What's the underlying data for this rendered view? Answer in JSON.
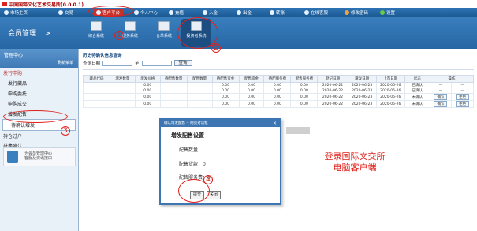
{
  "window": {
    "title": "中国国粹文化艺术交易所(0.0.0.1)"
  },
  "topnav": {
    "items": [
      {
        "label": "市场主页",
        "icon": "home-icon"
      },
      {
        "label": "交易",
        "icon": "trade-icon"
      },
      {
        "label": "客户平台",
        "icon": "client-icon",
        "active": true
      },
      {
        "label": "个人中心",
        "icon": "user-icon"
      },
      {
        "label": "充值",
        "icon": "recharge-icon"
      },
      {
        "label": "入金",
        "icon": "deposit-icon"
      },
      {
        "label": "出金",
        "icon": "withdraw-icon"
      },
      {
        "label": "转账",
        "icon": "transfer-icon"
      },
      {
        "label": "在线客服",
        "icon": "service-icon"
      },
      {
        "label": "修改密码",
        "icon": "key-icon"
      },
      {
        "label": "设置",
        "icon": "settings-icon"
      }
    ]
  },
  "header": {
    "member_label": "会员管理",
    "member_arrow": ">",
    "systems": [
      {
        "label": "综合系统",
        "icon": "system-icon"
      },
      {
        "label": "服务系统",
        "icon": "service-system-icon"
      },
      {
        "label": "仓单系统",
        "icon": "warehouse-icon"
      },
      {
        "label": "投资者系统",
        "icon": "investor-icon",
        "active": true
      }
    ]
  },
  "sidebar": {
    "title": "管理中心",
    "refresh": "刷新菜单",
    "section_issue": "发行申购",
    "items": [
      "发行藏品",
      "申购委托",
      "申购成交",
      "增发配售",
      "待确认增发"
    ],
    "active_item": "待确认增发",
    "section_settle": "持仓过户",
    "section_pay": "付费确认",
    "promo": {
      "line1": "为会员管理中心",
      "line2": "客服及资讯接口"
    }
  },
  "content": {
    "section_title": "历史待确认信息查询",
    "query": {
      "label": "查询日期",
      "to": "至",
      "button": "查询"
    },
    "columns": [
      "藏品代码",
      "增发数量",
      "增发价格",
      "待配售数量",
      "配售数量",
      "待配售资金",
      "配售资金",
      "待配服务费",
      "配售服务费",
      "登记日期",
      "增发日期",
      "上市日期",
      "状态",
      "操作"
    ],
    "rows": [
      [
        "",
        "",
        "0.00",
        "",
        "",
        "0.00",
        "0.00",
        "0.00",
        "0.00",
        "2020-06-22",
        "2020-06-23",
        "2020-06-26",
        "已确认",
        "—",
        "—"
      ],
      [
        "",
        "",
        "0.00",
        "",
        "",
        "0.00",
        "0.00",
        "0.00",
        "0.00",
        "2020-06-22",
        "2020-06-23",
        "2020-06-26",
        "已确认",
        "—",
        "—"
      ],
      [
        "",
        "",
        "0.00",
        "",
        "",
        "0.00",
        "0.00",
        "0.00",
        "0.00",
        "2020-06-22",
        "2020-06-23",
        "2020-06-26",
        "未确认",
        "确认",
        "拒绝"
      ],
      [
        "",
        "",
        "0.00",
        "",
        "",
        "0.00",
        "0.00",
        "0.00",
        "0.00",
        "2020-06-22",
        "2020-06-23",
        "2020-06-26",
        "未确认",
        "确认",
        "拒绝"
      ]
    ]
  },
  "dialog": {
    "bar": "确认增发配售 -- 网页对话框",
    "close": "×",
    "title": "增发配售设置",
    "labels": {
      "qty": "配售数量：",
      "amount": "配售货款：",
      "fee": "配售服务费："
    },
    "values": {
      "qty": "",
      "amount": "0",
      "fee": "0"
    },
    "submit": "提交",
    "close_btn": "关闭"
  },
  "annotations": {
    "num1": "1",
    "num2": "2",
    "num3": "3",
    "num4": "4",
    "caption_line1": "登录国际文交所",
    "caption_line2": "电脑客户端"
  }
}
